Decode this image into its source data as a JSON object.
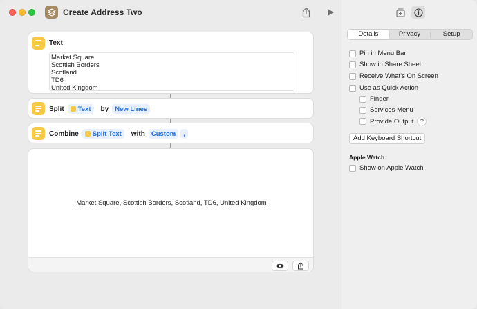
{
  "window": {
    "title": "Create Address Two"
  },
  "actions": {
    "text_action": {
      "title": "Text",
      "lines": [
        "Market Square",
        "Scottish Borders",
        "Scotland",
        "TD6",
        "United Kingdom"
      ]
    },
    "split_action": {
      "label": "Split",
      "input_token": "Text",
      "by_label": "by",
      "separator_token": "New Lines"
    },
    "combine_action": {
      "label": "Combine",
      "input_token": "Split Text",
      "with_label": "with",
      "mode_token": "Custom",
      "custom_token": ","
    }
  },
  "result": {
    "text": "Market Square, Scottish Borders, Scotland, TD6, United Kingdom"
  },
  "inspector": {
    "tabs": [
      "Details",
      "Privacy",
      "Setup"
    ],
    "selected_tab": "Details",
    "options": {
      "pin_menu_bar": "Pin in Menu Bar",
      "share_sheet": "Show in Share Sheet",
      "receive_screen": "Receive What’s On Screen",
      "quick_action": "Use as Quick Action",
      "finder": "Finder",
      "services_menu": "Services Menu",
      "provide_output": "Provide Output",
      "help": "?"
    },
    "keyboard_shortcut_button": "Add Keyboard Shortcut",
    "apple_watch_header": "Apple Watch",
    "show_on_watch": "Show on Apple Watch"
  },
  "colors": {
    "accent": "#1f6fe5",
    "action_icon": "#f7c947",
    "app_icon": "#a58a62"
  }
}
